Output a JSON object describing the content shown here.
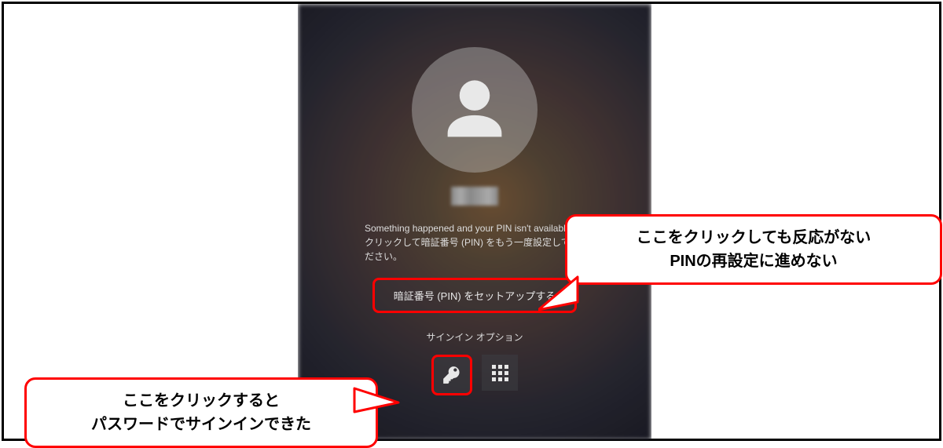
{
  "lockscreen": {
    "pin_message": "Something happened and your PIN isn't available. クリックして暗証番号 (PIN) をもう一度設定してください。",
    "setup_button_label": "暗証番号 (PIN) をセットアップする",
    "signin_options_label": "サインイン オプション"
  },
  "annotations": {
    "top_callout_line1": "ここをクリックしても反応がない",
    "top_callout_line2": "PINの再設定に進めない",
    "bottom_callout_line1": "ここをクリックすると",
    "bottom_callout_line2": "パスワードでサインインできた"
  },
  "colors": {
    "highlight": "#ff0000"
  }
}
